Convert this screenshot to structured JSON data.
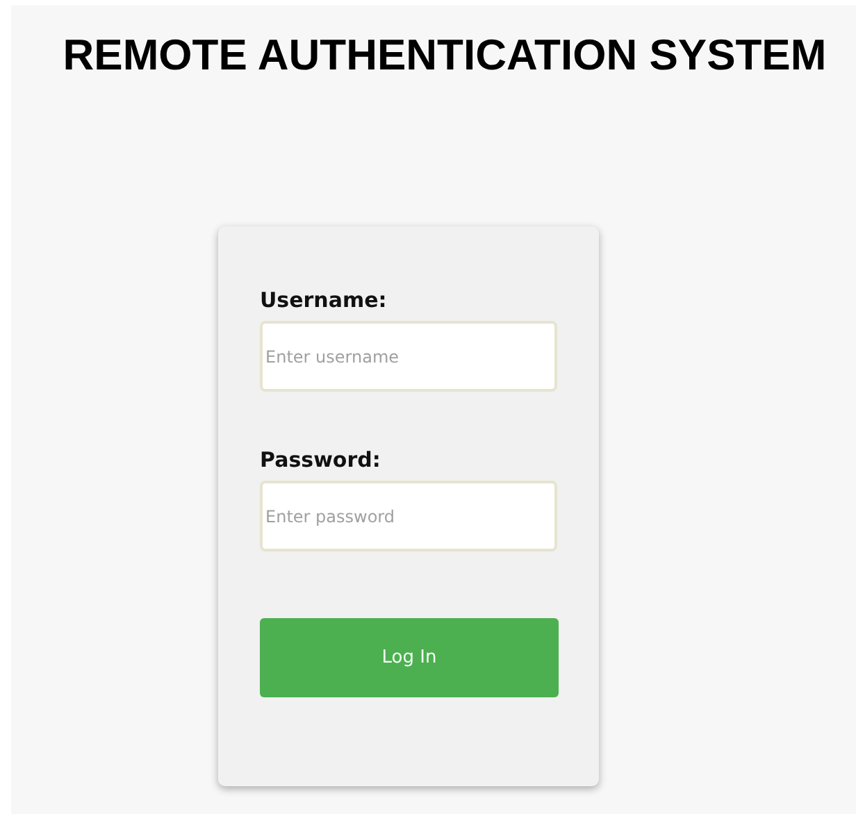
{
  "title": "REMOTE AUTHENTICATION SYSTEM",
  "login_form": {
    "fields": [
      {
        "label": "Username:",
        "placeholder": "Enter username"
      },
      {
        "label": "Password:",
        "placeholder": "Enter password"
      }
    ],
    "submit_button": "Log In"
  }
}
